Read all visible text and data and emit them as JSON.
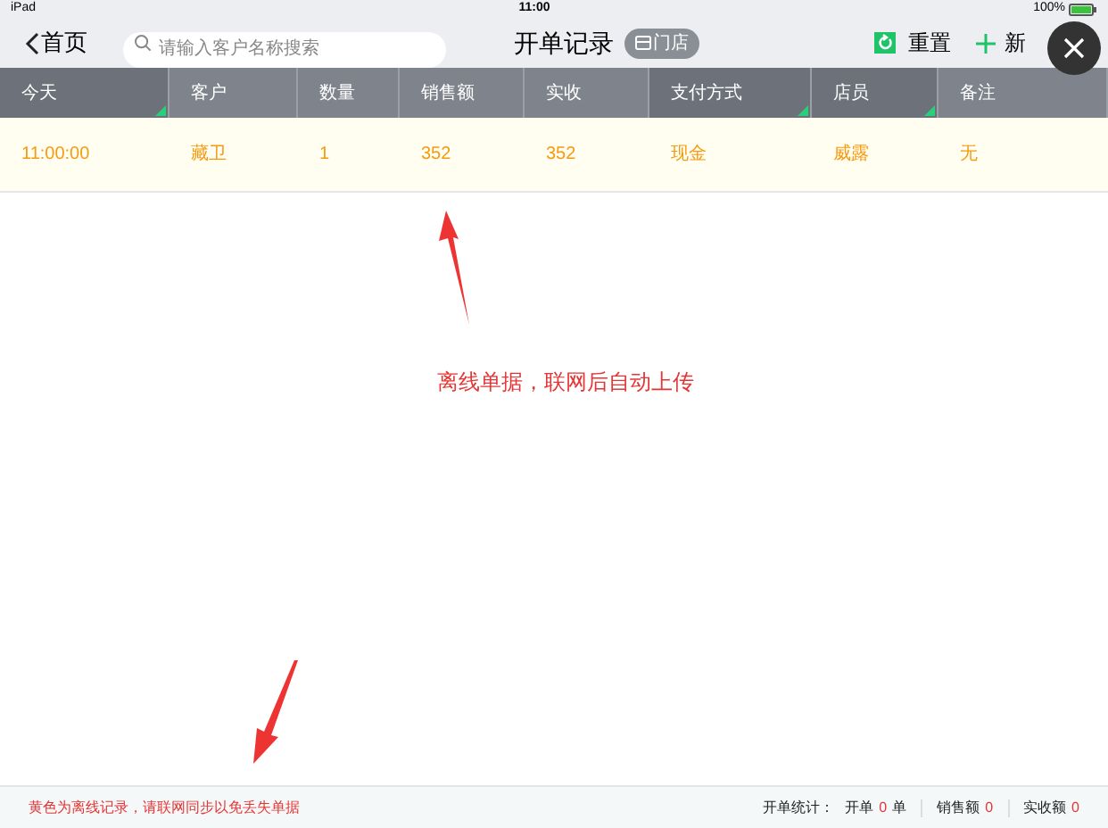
{
  "status_bar": {
    "device": "iPad",
    "time": "11:00",
    "battery": "100%"
  },
  "nav": {
    "back": "首页",
    "search": {
      "placeholder": "请输入客户名称搜索"
    },
    "title": "开单记录",
    "store_badge": "门店",
    "reset": "重置",
    "new": "新"
  },
  "table": {
    "columns": [
      {
        "label": "今天",
        "filter": true
      },
      {
        "label": "客户",
        "filter": false
      },
      {
        "label": "数量",
        "filter": false
      },
      {
        "label": "销售额",
        "filter": false
      },
      {
        "label": "实收",
        "filter": false
      },
      {
        "label": "支付方式",
        "filter": true
      },
      {
        "label": "店员",
        "filter": true
      },
      {
        "label": "备注",
        "filter": false
      }
    ],
    "rows": [
      {
        "offline": true,
        "cells": [
          "11:00:00",
          "藏卫",
          "1",
          "352",
          "352",
          "现金",
          "威露",
          "无"
        ]
      }
    ]
  },
  "annotations": [
    {
      "text": "离线单据，联网后自动上传"
    }
  ],
  "footer": {
    "note": "黄色为离线记录，请联网同步以免丢失单据",
    "stats_label": "开单统计：",
    "orders_label": "开单",
    "orders": "0",
    "orders_unit": "单",
    "sales_label": "销售额",
    "sales": "0",
    "received_label": "实收额",
    "received": "0"
  }
}
